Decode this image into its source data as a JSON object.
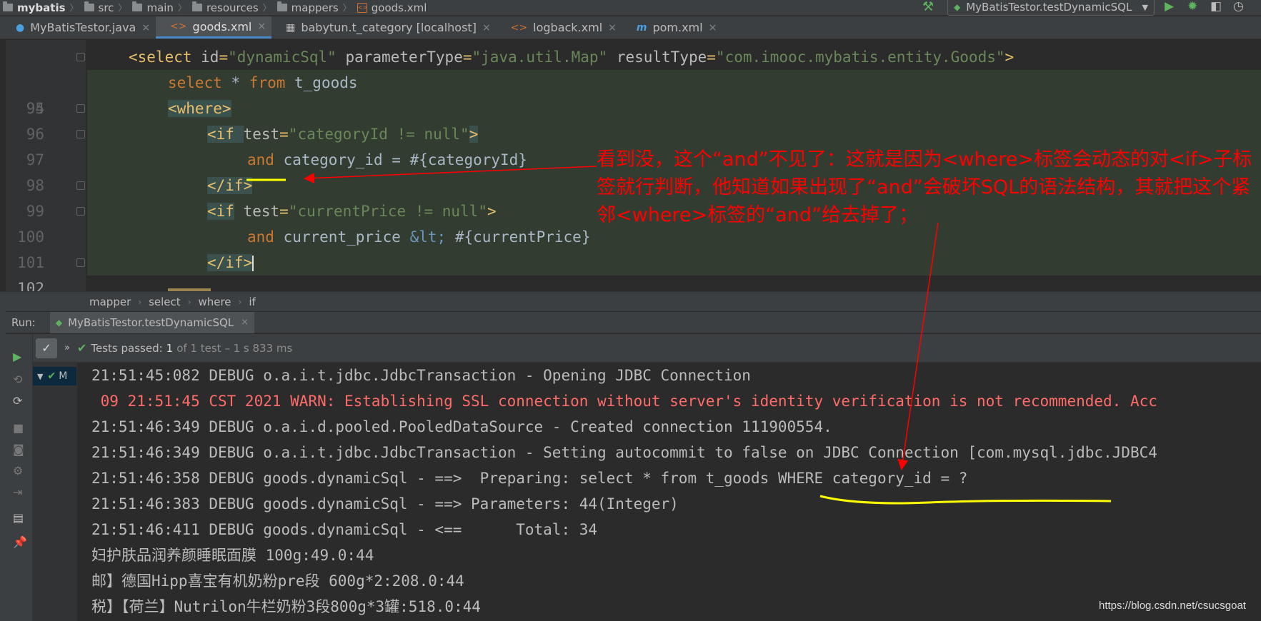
{
  "navbar": {
    "crumbs": [
      "mybatis",
      "src",
      "main",
      "resources",
      "mappers",
      "goods.xml"
    ],
    "run_config": "MyBatisTestor.testDynamicSQL"
  },
  "tabs": [
    {
      "label": "MyBatisTestor.java",
      "icon": "java-class-icon"
    },
    {
      "label": "goods.xml",
      "icon": "xml-file-icon",
      "active": true
    },
    {
      "label": "babytun.t_category [localhost]",
      "icon": "table-icon"
    },
    {
      "label": "logback.xml",
      "icon": "xml-file-icon"
    },
    {
      "label": "pom.xml",
      "icon": "maven-icon"
    }
  ],
  "editor": {
    "lines": [
      {
        "num": "94"
      },
      {
        "num": "95"
      },
      {
        "num": "96"
      },
      {
        "num": "97"
      },
      {
        "num": "98"
      },
      {
        "num": "99"
      },
      {
        "num": "100"
      },
      {
        "num": "101"
      },
      {
        "num": "102"
      }
    ],
    "code": {
      "l94_open": "<select ",
      "l94_a1": "id",
      "l94_v1": "\"dynamicSql\"",
      "l94_a2": "parameterType",
      "l94_v2": "\"java.util.Map\"",
      "l94_a3": "resultType",
      "l94_v3": "\"com.imooc.mybatis.entity.Goods\"",
      "l94_close": ">",
      "l95_select": "select",
      "l95_rest": " * ",
      "l95_from": "from",
      "l95_table": " t_goods",
      "l96": "<where>",
      "l97_open": "<if ",
      "l97_attr": "test",
      "l97_val": "\"categoryId != null\"",
      "l97_close": ">",
      "l98_and": "and",
      "l98_rest": " category_id = #{categoryId}",
      "l99": "</if>",
      "l100_open": "<if",
      "l100_attr": " test",
      "l100_val": "\"currentPrice != null\"",
      "l100_close": ">",
      "l101_and": "and",
      "l101_rest1": " current_price ",
      "l101_ent": "&lt;",
      "l101_rest2": " #{currentPrice}",
      "l102": "</if>"
    },
    "path": [
      "mapper",
      "select",
      "where",
      "if"
    ]
  },
  "run": {
    "label": "Run:",
    "tab": "MyBatisTestor.testDynamicSQL",
    "tests_passed_label": "Tests passed:",
    "tests_passed_count": "1",
    "tests_detail": "of 1 test – 1 s 833 ms",
    "tree_item": "M",
    "console": [
      {
        "text": "21:51:45:082 DEBUG o.a.i.t.jdbc.JdbcTransaction - Opening JDBC Connection",
        "warn": false
      },
      {
        "text": " 09 21:51:45 CST 2021 WARN: Establishing SSL connection without server's identity verification is not recommended. Acc",
        "warn": true
      },
      {
        "text": "21:51:46:349 DEBUG o.a.i.d.pooled.PooledDataSource - Created connection 111900554.",
        "warn": false
      },
      {
        "text": "21:51:46:349 DEBUG o.a.i.t.jdbc.JdbcTransaction - Setting autocommit to false on JDBC Connection [com.mysql.jdbc.JDBC4",
        "warn": false
      },
      {
        "text": "21:51:46:358 DEBUG goods.dynamicSql - ==>  Preparing: select * from t_goods WHERE category_id = ?",
        "warn": false
      },
      {
        "text": "21:51:46:383 DEBUG goods.dynamicSql - ==> Parameters: 44(Integer)",
        "warn": false
      },
      {
        "text": "21:51:46:411 DEBUG goods.dynamicSql - <==      Total: 34",
        "warn": false
      },
      {
        "text": "妇护肤品润养颜睡眠面膜 100g:49.0:44",
        "warn": false
      },
      {
        "text": "邮】德国Hipp喜宝有机奶粉pre段 600g*2:208.0:44",
        "warn": false
      },
      {
        "text": "税】【荷兰】Nutrilon牛栏奶粉3段800g*3罐:518.0:44",
        "warn": false
      }
    ]
  },
  "annotation": {
    "text": "看到没，这个“and”不见了：这就是因为<where>标签会动态的对<if>子标签就行判断，他知道如果出现了“and”会破坏SQL的语法结构，其就把这个紧邻<where>标签的“and”给去掉了；"
  },
  "watermark": "https://blog.csdn.net/csucsgoat",
  "colors": {
    "annotation": "#ff0000",
    "underline": "#ffff00",
    "warn": "#ff6b68",
    "pass": "#5fb25f"
  }
}
